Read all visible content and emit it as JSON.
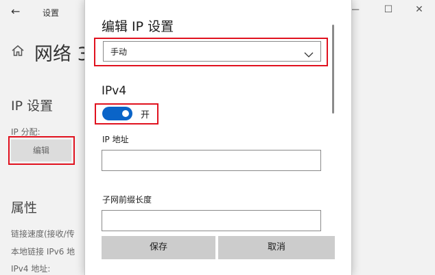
{
  "window": {
    "back_glyph": "←",
    "app_title": "设置",
    "minimize_glyph": "—",
    "maximize_glyph": "☐",
    "close_glyph": "✕"
  },
  "background_page": {
    "title": "网络 3",
    "ip_section": "IP 设置",
    "ip_assignment_label": "IP 分配:",
    "edit_button": "编辑",
    "properties_section": "属性",
    "properties_lines": [
      "链接速度(接收/传",
      "本地链接 IPv6 地",
      "IPv4 地址:"
    ]
  },
  "dialog": {
    "title": "编辑 IP 设置",
    "mode_select_value": "手动",
    "ipv4_title": "IPv4",
    "ipv4_toggle_state": "on",
    "ipv4_toggle_label": "开",
    "ip_address_label": "IP 地址",
    "ip_address_value": "",
    "subnet_prefix_label": "子网前缀长度",
    "subnet_prefix_value": "",
    "save_button": "保存",
    "cancel_button": "取消"
  },
  "colors": {
    "highlight": "#e0101d",
    "toggle_on": "#0a64c8",
    "button_bg": "#cccccc"
  }
}
